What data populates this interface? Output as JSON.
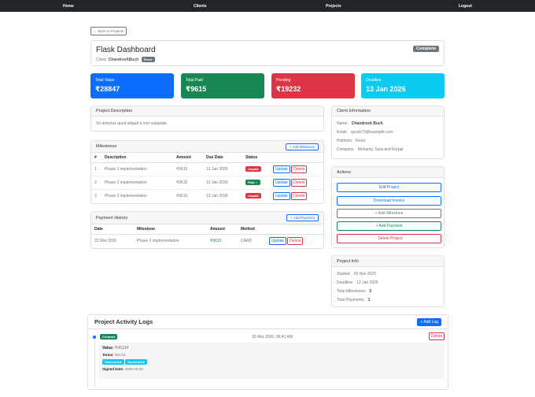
{
  "nav": {
    "items": [
      "Home",
      "Clients",
      "Projects",
      "Logout"
    ]
  },
  "back_label": "← Back to Projects",
  "project": {
    "title": "Flask Dashboard",
    "client_prefix": "Client:",
    "client_name": "ChandreshBuch",
    "client_badge": "Fiverr",
    "status": "Complete"
  },
  "stats": [
    {
      "label": "Total Value",
      "value": "₹28847",
      "color": "#0d6efd"
    },
    {
      "label": "Total Paid",
      "value": "₹9615",
      "color": "#198754"
    },
    {
      "label": "Pending",
      "value": "₹19232",
      "color": "#dc3545"
    },
    {
      "label": "Deadline",
      "value": "13 Jan 2026",
      "color": "#0dcaf0"
    }
  ],
  "description": {
    "header": "Project Description",
    "text": "Sit delectus quod aliquid a non voluptate."
  },
  "milestones": {
    "header": "Milestones",
    "add_label": "+ Add Milestone",
    "columns": [
      "#",
      "Description",
      "Amount",
      "Due Date",
      "Status"
    ],
    "rows": [
      {
        "num": "1",
        "desc": "Phase 1 implementation",
        "amount": "₹9615",
        "due": "13 Jan 2026",
        "status": "Unpaid"
      },
      {
        "num": "2",
        "desc": "Phase 2 implementation",
        "amount": "₹9615",
        "due": "13 Jan 2026",
        "status": "Paid ✓"
      },
      {
        "num": "3",
        "desc": "Phase 3 implementation",
        "amount": "₹9615",
        "due": "13 Jan 2026",
        "status": "Unpaid"
      }
    ],
    "update_label": "Update",
    "delete_label": "Delete"
  },
  "payments": {
    "header": "Payment History",
    "add_label": "+ Add Payment",
    "columns": [
      "Date",
      "Milestone",
      "Amount",
      "Method"
    ],
    "rows": [
      {
        "date": "22 Mar 2026",
        "milestone": "Phase 2 implementation",
        "amount": "₹9615",
        "method": "CARD"
      }
    ],
    "update_label": "Update",
    "delete_label": "Delete"
  },
  "client_info": {
    "header": "Client Information",
    "rows": [
      {
        "label": "Name:",
        "value": "Chandresh Buch"
      },
      {
        "label": "Email:",
        "value": "ayush73@example.com"
      },
      {
        "label": "Platform:",
        "value": "Fiverr"
      },
      {
        "label": "Company:",
        "value": "Mohanty, Sura and Korpal"
      }
    ]
  },
  "actions": {
    "header": "Actions",
    "buttons": [
      "Edit Project",
      "Download Invoice",
      "+ Add Milestone",
      "+ Add Payment",
      "- Delete Project"
    ]
  },
  "project_info": {
    "header": "Project Info",
    "rows": [
      {
        "label": "Started:",
        "value": "29 Nov 2025"
      },
      {
        "label": "Deadline:",
        "value": "13 Jan 2026"
      },
      {
        "label": "Total Milestones:",
        "value": "3"
      },
      {
        "label": "Total Payments:",
        "value": "1"
      }
    ]
  },
  "activity": {
    "header": "Project Activity Logs",
    "add_label": "+ Add Log",
    "log": {
      "badge": "Contract",
      "timestamp": "30 Mar 2026, 06:41 AM",
      "delete_label": "Delete",
      "value_label": "Value:",
      "value": "₹45134",
      "terms_label": "Terms:",
      "terms": "Net-15",
      "links": [
        "SourceLink",
        "SourceLink"
      ],
      "signed_label": "Signed Date:",
      "signed": "2026-03-30"
    }
  }
}
